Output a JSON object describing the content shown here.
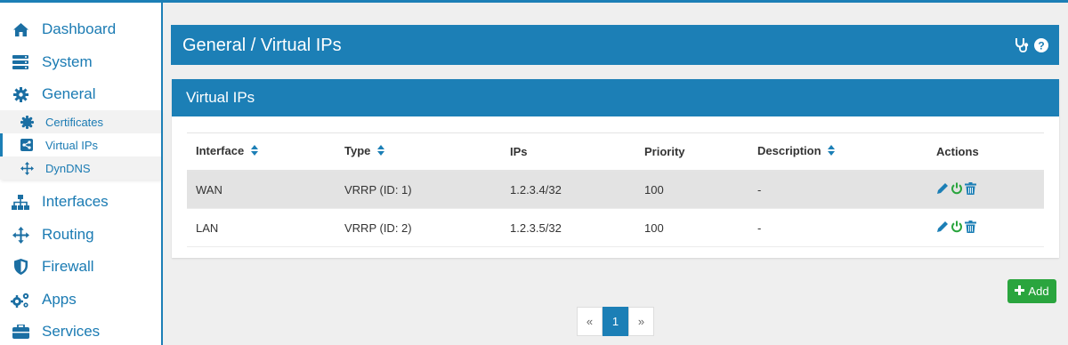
{
  "sidebar": {
    "items": [
      {
        "label": "Dashboard",
        "icon": "home-icon"
      },
      {
        "label": "System",
        "icon": "server-icon"
      },
      {
        "label": "General",
        "icon": "gear-icon"
      },
      {
        "label": "Interfaces",
        "icon": "sitemap-icon"
      },
      {
        "label": "Routing",
        "icon": "move-arrows-icon"
      },
      {
        "label": "Firewall",
        "icon": "shield-icon"
      },
      {
        "label": "Apps",
        "icon": "cogs-icon"
      },
      {
        "label": "Services",
        "icon": "briefcase-icon"
      }
    ],
    "subitems": [
      {
        "label": "Certificates",
        "icon": "certificate-icon"
      },
      {
        "label": "Virtual IPs",
        "icon": "share-icon",
        "active": true
      },
      {
        "label": "DynDNS",
        "icon": "move-arrows-icon"
      }
    ]
  },
  "header": {
    "title": "General / Virtual IPs",
    "icons": [
      "stethoscope-icon",
      "help-icon"
    ]
  },
  "panel": {
    "title": "Virtual IPs",
    "columns": [
      "Interface",
      "Type",
      "IPs",
      "Priority",
      "Description",
      "Actions"
    ],
    "rows": [
      {
        "interface": "WAN",
        "type": "VRRP (ID: 1)",
        "ips": "1.2.3.4/32",
        "priority": "100",
        "description": "-"
      },
      {
        "interface": "LAN",
        "type": "VRRP (ID: 2)",
        "ips": "1.2.3.5/32",
        "priority": "100",
        "description": "-"
      }
    ]
  },
  "add_button": {
    "label": "Add"
  },
  "pagination": {
    "prev": "«",
    "current": "1",
    "next": "»"
  },
  "colors": {
    "accent": "#1c7fb6",
    "success": "#2aa53e"
  }
}
